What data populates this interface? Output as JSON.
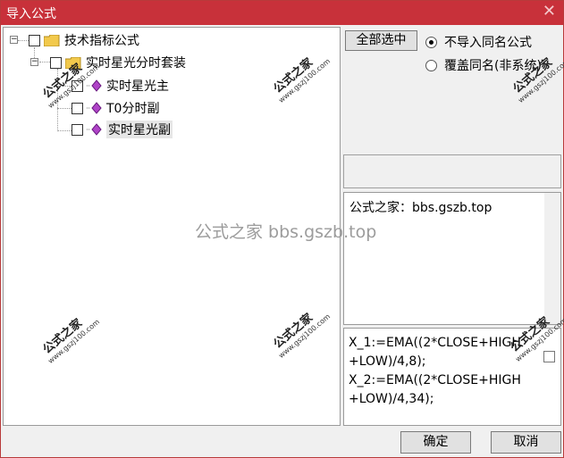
{
  "window": {
    "title": "导入公式",
    "close_glyph": "✕"
  },
  "tree": {
    "root": {
      "label": "技术指标公式",
      "expander": "−"
    },
    "group": {
      "label": "实时星光分时套装",
      "expander": "−"
    },
    "items": [
      {
        "label": "实时星光主"
      },
      {
        "label": "T0分时副"
      },
      {
        "label": "实时星光副"
      }
    ]
  },
  "options": {
    "select_all_label": "全部选中",
    "radio_skip_label": "不导入同名公式",
    "radio_overwrite_label": "覆盖同名(非系统)",
    "selected_radio": "skip"
  },
  "info": {
    "text": "公式之家：bbs.gszb.top"
  },
  "code": {
    "lines": [
      "X_1:=EMA((2*CLOSE+HIGH",
      "+LOW)/4,8);",
      "X_2:=EMA((2*CLOSE+HIGH",
      "+LOW)/4,34);"
    ]
  },
  "buttons": {
    "ok_label": "确定",
    "cancel_label": "取消"
  },
  "watermarks": {
    "site_cn": "公式之家",
    "site_url": "www.gszj100.com",
    "center": "公式之家 bbs.gszb.top"
  },
  "colors": {
    "titlebar": "#c8313a",
    "folder": "#f2c94c",
    "gem": "#b044c8"
  }
}
